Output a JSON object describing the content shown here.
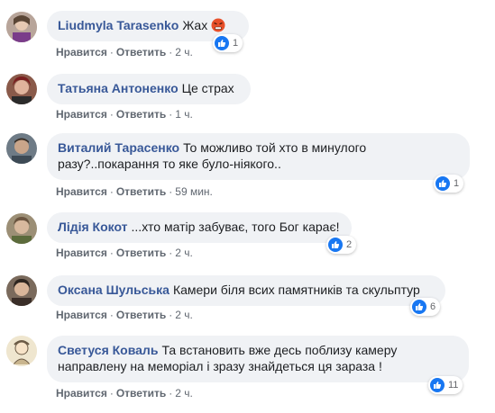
{
  "actions": {
    "like": "Нравится",
    "reply": "Ответить",
    "sep": "·"
  },
  "comments": [
    {
      "author": "Liudmyla Tarasenko",
      "text": "Жах",
      "emoji": "angry-face-icon",
      "time": "2 ч.",
      "likes": "1"
    },
    {
      "author": "Татьяна Антоненко",
      "text": "Це страх",
      "time": "1 ч."
    },
    {
      "author": "Виталий Тарасенко",
      "text_line1": "То можливо той хто в минулого",
      "text_line2": "разу?..покарання то яке було-ніякого..",
      "time": "59 мин.",
      "likes": "1"
    },
    {
      "author": "Лідія Кокот",
      "text": "...хто матір забуває, того Бог карає!",
      "time": "2 ч.",
      "likes": "2"
    },
    {
      "author": "Оксана Шульська",
      "text": "Камери біля всих памятників та скульптур",
      "time": "2 ч.",
      "likes": "6"
    },
    {
      "author": "Светуся Коваль",
      "text_line1": "Та встановить вже десь поблизу камеру",
      "text_line2": "направлену на меморіал і зразу знайдеться ця зараза !",
      "time": "2 ч.",
      "likes": "11"
    }
  ],
  "colors": {
    "author": "#385898",
    "bubble": "#f0f2f5",
    "like": "#1877f2",
    "meta": "#606770"
  }
}
